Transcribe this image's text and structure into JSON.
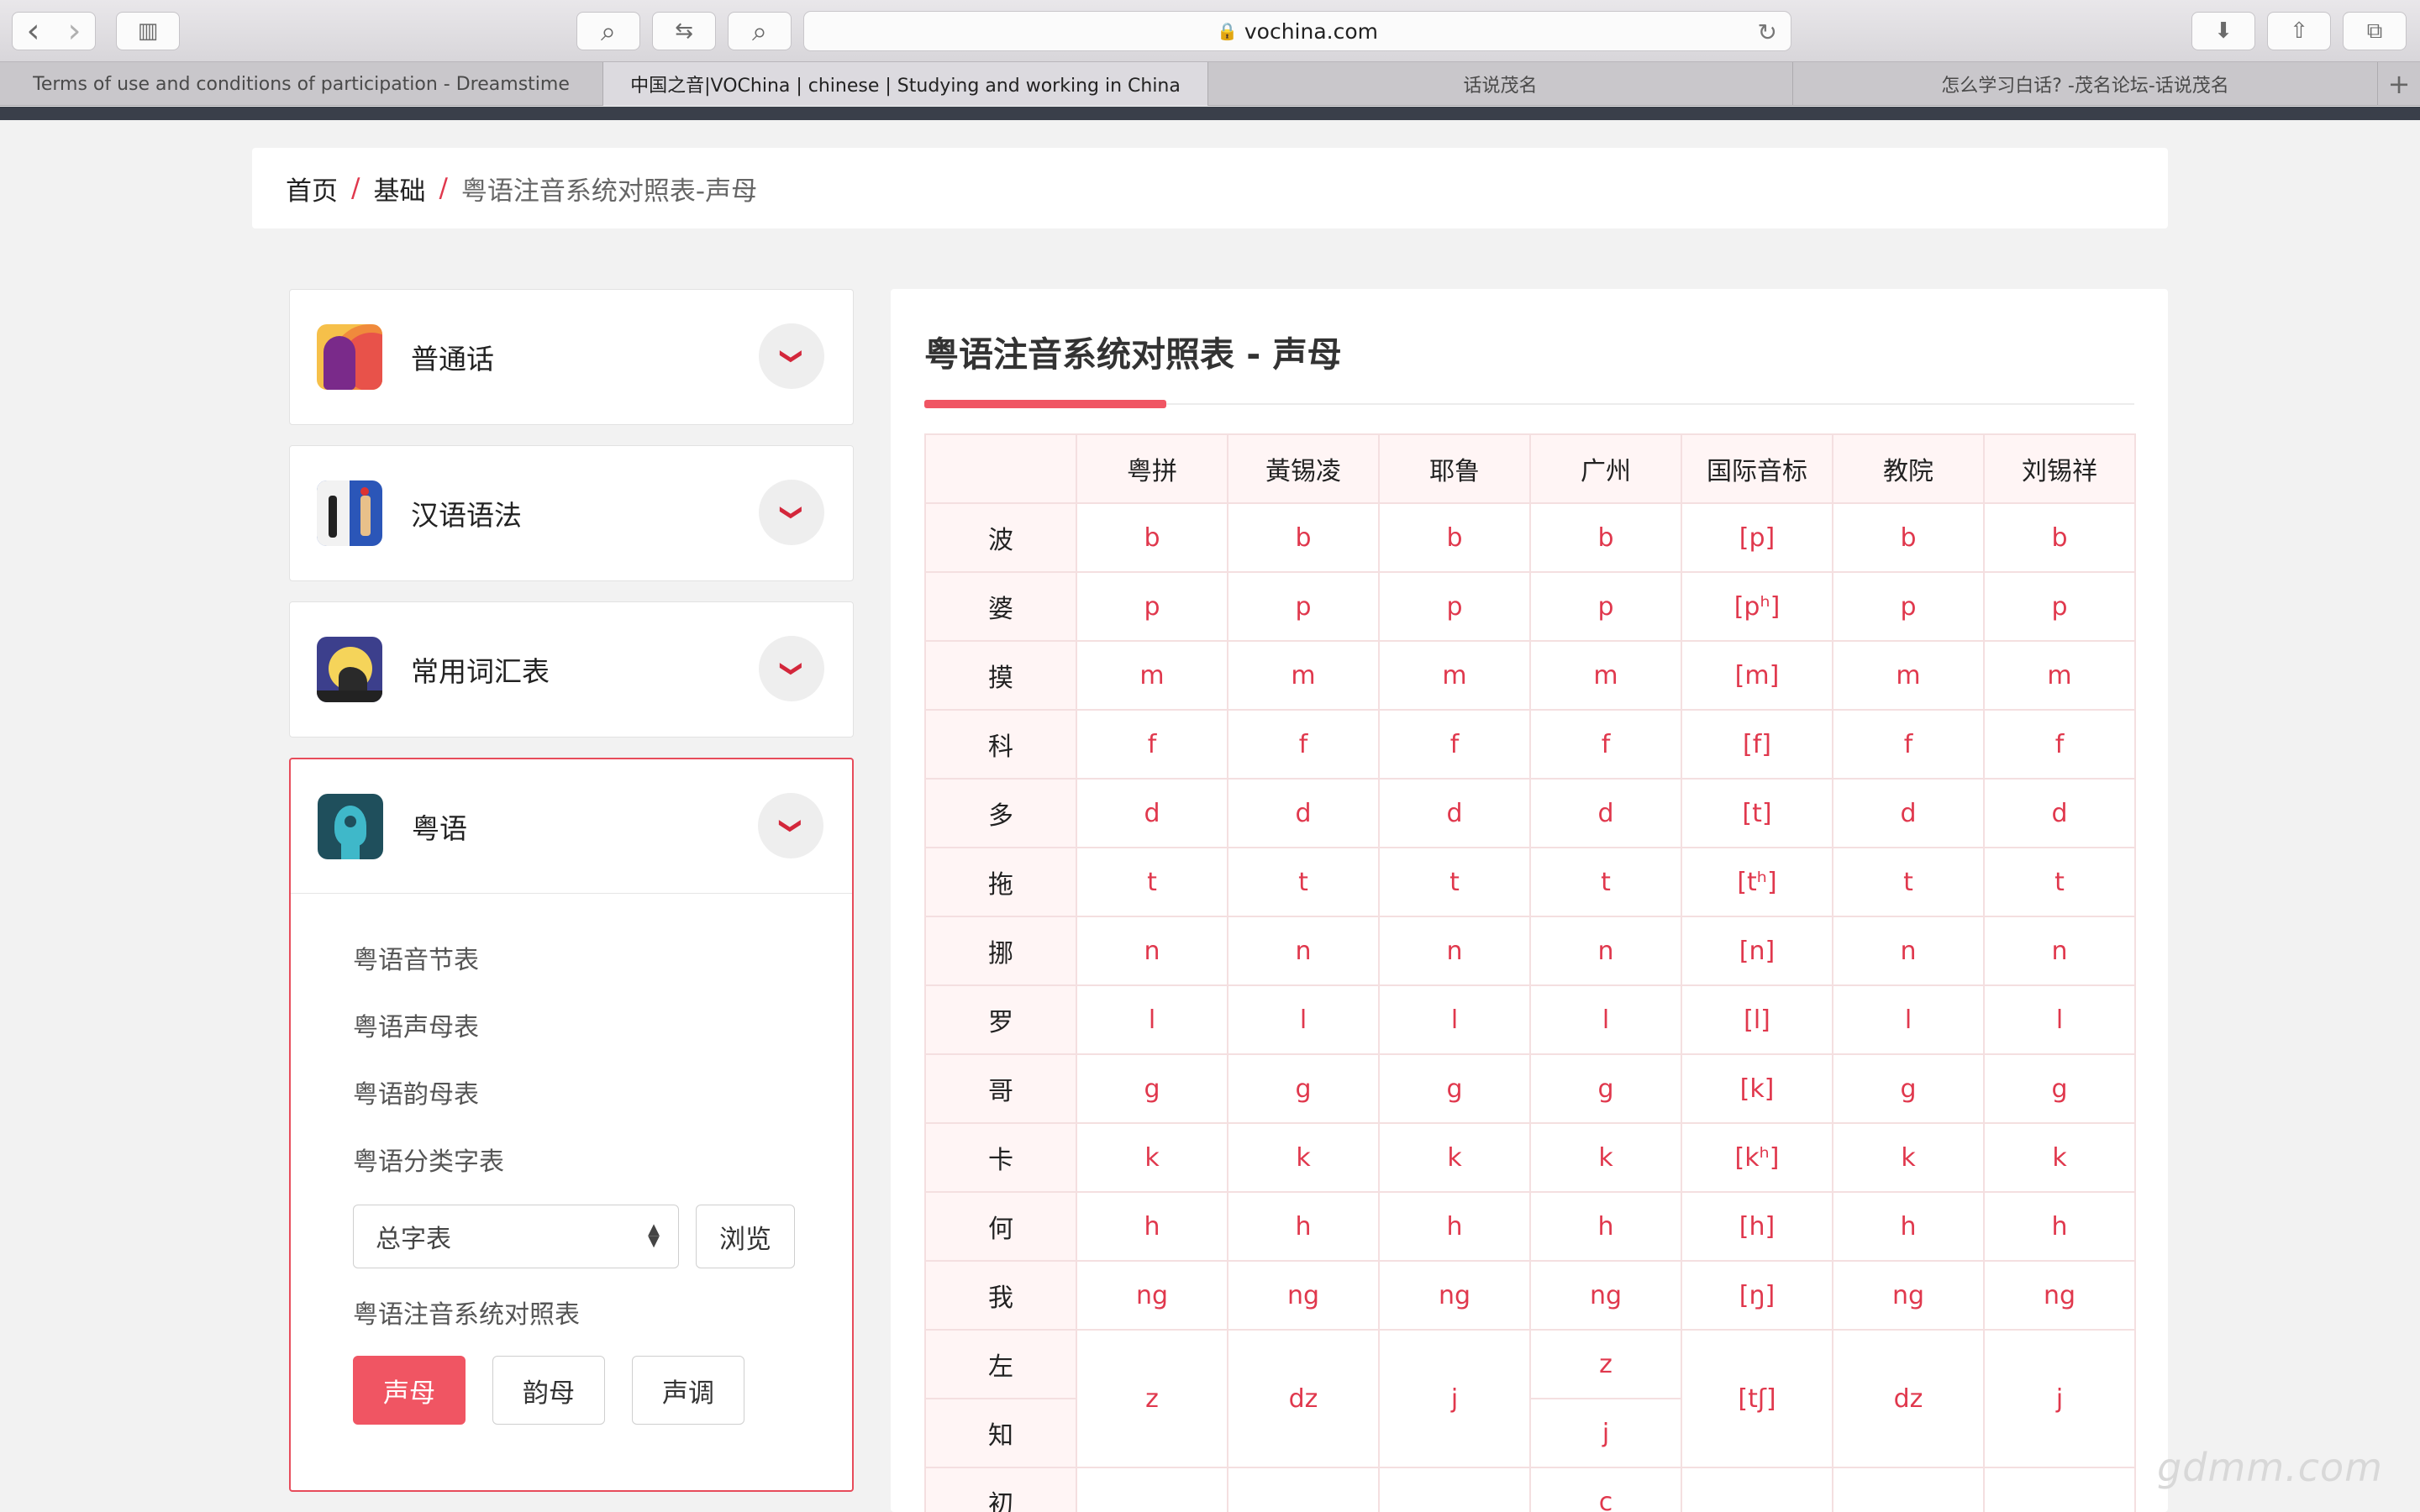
{
  "browser": {
    "url": "vochina.com",
    "tabs": [
      {
        "label": "Terms of use and conditions of participation - Dreamstime"
      },
      {
        "label": "中国之音|VOChina | chinese | Studying and working in China"
      },
      {
        "label": "话说茂名"
      },
      {
        "label": "怎么学习白话? -茂名论坛-话说茂名"
      }
    ],
    "new_tab_icon": "+",
    "icons": {
      "back": "‹",
      "forward": "›",
      "sidebar": "▥",
      "search": "⌕",
      "swap": "⇆",
      "find": "⌕",
      "lock": "🔒",
      "reload": "↻",
      "download": "⬇",
      "share": "⇧",
      "tabs": "⧉"
    }
  },
  "breadcrumb": {
    "home": "首页",
    "basics": "基础",
    "current": "粤语注音系统对照表-声母",
    "separator": "/"
  },
  "sidebar": {
    "cards": [
      {
        "title": "普通话",
        "icon": "mandarin-icon"
      },
      {
        "title": "汉语语法",
        "icon": "grammar-icon"
      },
      {
        "title": "常用词汇表",
        "icon": "vocabulary-icon"
      },
      {
        "title": "粤语",
        "icon": "cantonese-icon"
      }
    ],
    "chevron": "❯",
    "cantonese_items": [
      "粤语音节表",
      "粤语声母表",
      "粤语韵母表",
      "粤语分类字表"
    ],
    "select": {
      "value": "总字表"
    },
    "browse_button": "浏览",
    "system_table_link": "粤语注音系统对照表",
    "type_buttons": [
      "声母",
      "韵母",
      "声调"
    ]
  },
  "main": {
    "title": "粤语注音系统对照表 - 声母",
    "table": {
      "headers": [
        "",
        "粤拼",
        "黃锡凌",
        "耶鲁",
        "广州",
        "国际音标",
        "教院",
        "刘锡祥"
      ],
      "rows": [
        {
          "char": "波",
          "cells": [
            "b",
            "b",
            "b",
            "b",
            "[p]",
            "b",
            "b"
          ]
        },
        {
          "char": "婆",
          "cells": [
            "p",
            "p",
            "p",
            "p",
            "[pʰ]",
            "p",
            "p"
          ]
        },
        {
          "char": "摸",
          "cells": [
            "m",
            "m",
            "m",
            "m",
            "[m]",
            "m",
            "m"
          ]
        },
        {
          "char": "科",
          "cells": [
            "f",
            "f",
            "f",
            "f",
            "[f]",
            "f",
            "f"
          ]
        },
        {
          "char": "多",
          "cells": [
            "d",
            "d",
            "d",
            "d",
            "[t]",
            "d",
            "d"
          ]
        },
        {
          "char": "拖",
          "cells": [
            "t",
            "t",
            "t",
            "t",
            "[tʰ]",
            "t",
            "t"
          ]
        },
        {
          "char": "挪",
          "cells": [
            "n",
            "n",
            "n",
            "n",
            "[n]",
            "n",
            "n"
          ]
        },
        {
          "char": "罗",
          "cells": [
            "l",
            "l",
            "l",
            "l",
            "[l]",
            "l",
            "l"
          ]
        },
        {
          "char": "哥",
          "cells": [
            "g",
            "g",
            "g",
            "g",
            "[k]",
            "g",
            "g"
          ]
        },
        {
          "char": "卡",
          "cells": [
            "k",
            "k",
            "k",
            "k",
            "[kʰ]",
            "k",
            "k"
          ]
        },
        {
          "char": "何",
          "cells": [
            "h",
            "h",
            "h",
            "h",
            "[h]",
            "h",
            "h"
          ]
        },
        {
          "char": "我",
          "cells": [
            "ng",
            "ng",
            "ng",
            "ng",
            "[ŋ]",
            "ng",
            "ng"
          ]
        }
      ],
      "merged": {
        "chars": [
          "左",
          "知"
        ],
        "jyutping": "z",
        "yale_huang": "dz",
        "yale": "j",
        "guangzhou_top": "z",
        "guangzhou_bottom": "j",
        "ipa": "[tʃ]",
        "edb": "dz",
        "sidney_lau": "j"
      },
      "partial_row": {
        "char": "初",
        "guangzhou": "c"
      }
    }
  },
  "watermark": "gdmm.com"
}
